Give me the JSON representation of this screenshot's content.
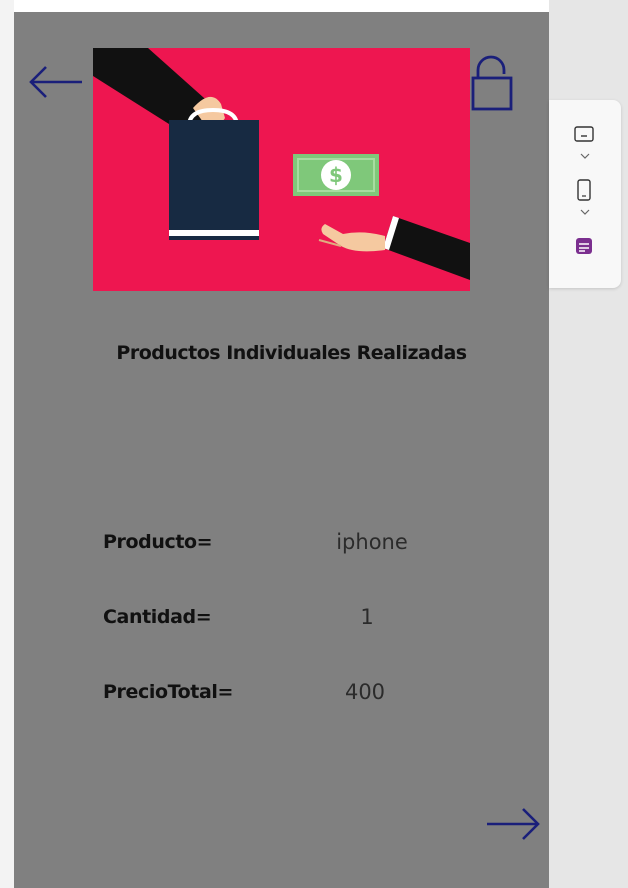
{
  "screen": {
    "title": "Productos Individuales Realizadas",
    "background_color": "#808080"
  },
  "banner": {
    "icon": "shopping-payment-illustration",
    "background_color": "#ee1650"
  },
  "header": {
    "back_icon": "arrow-left-icon",
    "lock_icon": "unlock-icon"
  },
  "details": {
    "rows": [
      {
        "label": "Producto=",
        "value": "iphone"
      },
      {
        "label": "Cantidad=",
        "value": "1"
      },
      {
        "label": "PrecioTotal=",
        "value": "400"
      }
    ]
  },
  "footer": {
    "next_icon": "arrow-right-icon"
  },
  "side_toolbar": {
    "items": [
      "keyboard-icon",
      "phone-icon",
      "form-icon"
    ],
    "accent_color": "#7b2f8f"
  }
}
